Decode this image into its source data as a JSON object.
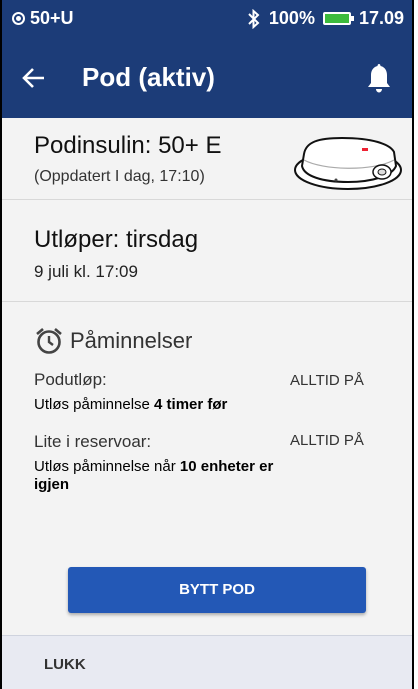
{
  "status_bar": {
    "pod_status": "50+U",
    "battery_percent": "100%",
    "time": "17.09",
    "icons": [
      "pod-status-icon",
      "bluetooth-icon",
      "battery-icon"
    ]
  },
  "app_bar": {
    "title": "Pod (aktiv)",
    "icons": [
      "back-arrow-icon",
      "bell-icon"
    ]
  },
  "insulin": {
    "label": "Podinsulin: 50+ E",
    "updated": "(Oppdatert I dag, 17:10)",
    "image": "pod-device-image"
  },
  "expiry": {
    "label": "Utløper: tirsdag",
    "date": "9 juli kl. 17:09"
  },
  "reminders": {
    "heading": "Påminnelser",
    "icon": "alarm-clock-icon",
    "items": [
      {
        "label": "Podutløp:",
        "status": "ALLTID PÅ",
        "desc_prefix": "Utløs påminnelse ",
        "desc_bold": "4 timer før",
        "desc_suffix": ""
      },
      {
        "label": "Lite i reservoar:",
        "status": "ALLTID PÅ",
        "desc_prefix": "Utløs påminnelse når ",
        "desc_bold": "10 enheter",
        "desc_suffix": " er igjen"
      }
    ]
  },
  "actions": {
    "replace_pod": "BYTT POD",
    "close": "LUKK"
  },
  "colors": {
    "header": "#1c3c78",
    "button": "#2358b6",
    "battery": "#3dbb3d"
  }
}
